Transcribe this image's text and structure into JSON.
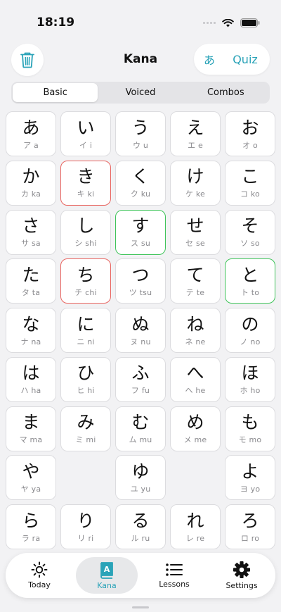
{
  "status": {
    "time": "18:19"
  },
  "header": {
    "title": "Kana",
    "kana_toggle": "あ",
    "quiz_label": "Quiz"
  },
  "segments": [
    "Basic",
    "Voiced",
    "Combos"
  ],
  "active_segment": "Basic",
  "grid": [
    {
      "kana": "あ",
      "sub": "ア a",
      "state": ""
    },
    {
      "kana": "い",
      "sub": "イ i",
      "state": ""
    },
    {
      "kana": "う",
      "sub": "ウ u",
      "state": ""
    },
    {
      "kana": "え",
      "sub": "エ e",
      "state": ""
    },
    {
      "kana": "お",
      "sub": "オ o",
      "state": ""
    },
    {
      "kana": "か",
      "sub": "カ ka",
      "state": ""
    },
    {
      "kana": "き",
      "sub": "キ ki",
      "state": "red"
    },
    {
      "kana": "く",
      "sub": "ク ku",
      "state": ""
    },
    {
      "kana": "け",
      "sub": "ケ ke",
      "state": ""
    },
    {
      "kana": "こ",
      "sub": "コ ko",
      "state": ""
    },
    {
      "kana": "さ",
      "sub": "サ sa",
      "state": ""
    },
    {
      "kana": "し",
      "sub": "シ shi",
      "state": ""
    },
    {
      "kana": "す",
      "sub": "ス su",
      "state": "green"
    },
    {
      "kana": "せ",
      "sub": "セ se",
      "state": ""
    },
    {
      "kana": "そ",
      "sub": "ソ so",
      "state": ""
    },
    {
      "kana": "た",
      "sub": "タ ta",
      "state": ""
    },
    {
      "kana": "ち",
      "sub": "チ chi",
      "state": "red"
    },
    {
      "kana": "つ",
      "sub": "ツ tsu",
      "state": ""
    },
    {
      "kana": "て",
      "sub": "テ te",
      "state": ""
    },
    {
      "kana": "と",
      "sub": "ト to",
      "state": "green"
    },
    {
      "kana": "な",
      "sub": "ナ na",
      "state": ""
    },
    {
      "kana": "に",
      "sub": "ニ ni",
      "state": ""
    },
    {
      "kana": "ぬ",
      "sub": "ヌ nu",
      "state": ""
    },
    {
      "kana": "ね",
      "sub": "ネ ne",
      "state": ""
    },
    {
      "kana": "の",
      "sub": "ノ no",
      "state": ""
    },
    {
      "kana": "は",
      "sub": "ハ ha",
      "state": ""
    },
    {
      "kana": "ひ",
      "sub": "ヒ hi",
      "state": ""
    },
    {
      "kana": "ふ",
      "sub": "フ fu",
      "state": ""
    },
    {
      "kana": "へ",
      "sub": "ヘ he",
      "state": ""
    },
    {
      "kana": "ほ",
      "sub": "ホ ho",
      "state": ""
    },
    {
      "kana": "ま",
      "sub": "マ ma",
      "state": ""
    },
    {
      "kana": "み",
      "sub": "ミ mi",
      "state": ""
    },
    {
      "kana": "む",
      "sub": "ム mu",
      "state": ""
    },
    {
      "kana": "め",
      "sub": "メ me",
      "state": ""
    },
    {
      "kana": "も",
      "sub": "モ mo",
      "state": ""
    },
    {
      "kana": "や",
      "sub": "ヤ ya",
      "state": ""
    },
    {
      "kana": "",
      "sub": "",
      "state": "empty"
    },
    {
      "kana": "ゆ",
      "sub": "ユ yu",
      "state": ""
    },
    {
      "kana": "",
      "sub": "",
      "state": "empty"
    },
    {
      "kana": "よ",
      "sub": "ヨ yo",
      "state": ""
    },
    {
      "kana": "ら",
      "sub": "ラ ra",
      "state": ""
    },
    {
      "kana": "り",
      "sub": "リ ri",
      "state": ""
    },
    {
      "kana": "る",
      "sub": "ル ru",
      "state": ""
    },
    {
      "kana": "れ",
      "sub": "レ re",
      "state": ""
    },
    {
      "kana": "ろ",
      "sub": "ロ ro",
      "state": ""
    }
  ],
  "tabs": [
    {
      "label": "Today",
      "icon": "sun-icon"
    },
    {
      "label": "Kana",
      "icon": "book-icon"
    },
    {
      "label": "Lessons",
      "icon": "list-icon"
    },
    {
      "label": "Settings",
      "icon": "gear-icon"
    }
  ],
  "active_tab": "Kana",
  "colors": {
    "accent": "#2aa3b8",
    "wrong": "#e8645f",
    "right": "#3fc45a"
  }
}
